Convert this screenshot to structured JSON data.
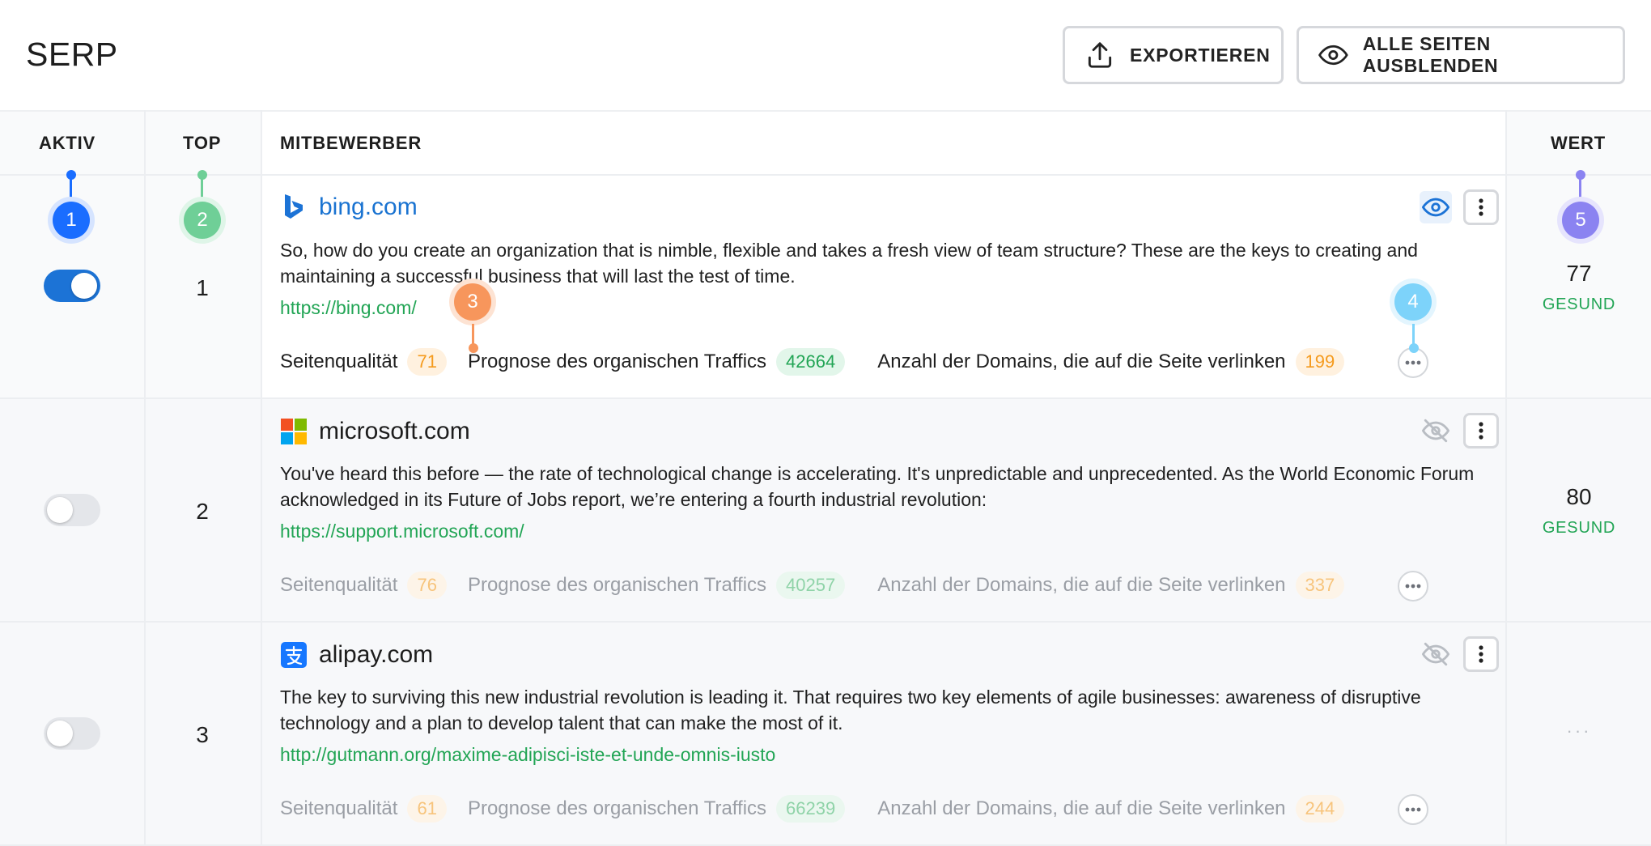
{
  "header": {
    "title": "SERP",
    "export_label": "EXPORTIEREN",
    "hide_all_label": "ALLE SEITEN AUSBLENDEN"
  },
  "columns": {
    "aktiv": "AKTIV",
    "top": "TOP",
    "mitbewerber": "MITBEWERBER",
    "wert": "WERT"
  },
  "metric_labels": {
    "quality": "Seitenqualität",
    "traffic": "Prognose des organischen Traffics",
    "domains": "Anzahl der Domains, die auf die Seite verlinken"
  },
  "rows": [
    {
      "active": true,
      "rank": "1",
      "domain": "bing.com",
      "favicon": "bing-icon",
      "description": "So, how do you create an organization that is nimble, flexible and takes a fresh view of team structure? These are the keys to creating and maintaining a successful business that will last the test of time.",
      "url": "https://bing.com/",
      "quality": "71",
      "traffic": "42664",
      "domains": "199",
      "visible": true,
      "value": "77",
      "status": "GESUND"
    },
    {
      "active": false,
      "rank": "2",
      "domain": "microsoft.com",
      "favicon": "microsoft-icon",
      "description": "You've heard this before — the rate of technological change is accelerating. It's unpredictable and unprecedented. As the World Economic Forum acknowledged in its Future of Jobs report, we’re entering a fourth industrial revolution:",
      "url": "https://support.microsoft.com/",
      "quality": "76",
      "traffic": "40257",
      "domains": "337",
      "visible": false,
      "value": "80",
      "status": "GESUND"
    },
    {
      "active": false,
      "rank": "3",
      "domain": "alipay.com",
      "favicon": "alipay-icon",
      "description": "The key to surviving this new industrial revolution is leading it. That requires two key elements of agile businesses: awareness of disruptive technology and a plan to develop talent that can make the most of it.",
      "url": "http://gutmann.org/maxime-adipisci-iste-et-unde-omnis-iusto",
      "quality": "61",
      "traffic": "66239",
      "domains": "244",
      "visible": false,
      "value": "···",
      "status": ""
    }
  ],
  "markers": [
    {
      "label": "1",
      "color": "#1a6dff"
    },
    {
      "label": "2",
      "color": "#6fcf97"
    },
    {
      "label": "3",
      "color": "#f7965c"
    },
    {
      "label": "4",
      "color": "#7dd3fa"
    },
    {
      "label": "5",
      "color": "#8b83f1"
    }
  ],
  "colors": {
    "accent": "#1c73d6",
    "link": "#1a73d1",
    "url_green": "#22a555",
    "badge_orange": "#f59b1e"
  }
}
